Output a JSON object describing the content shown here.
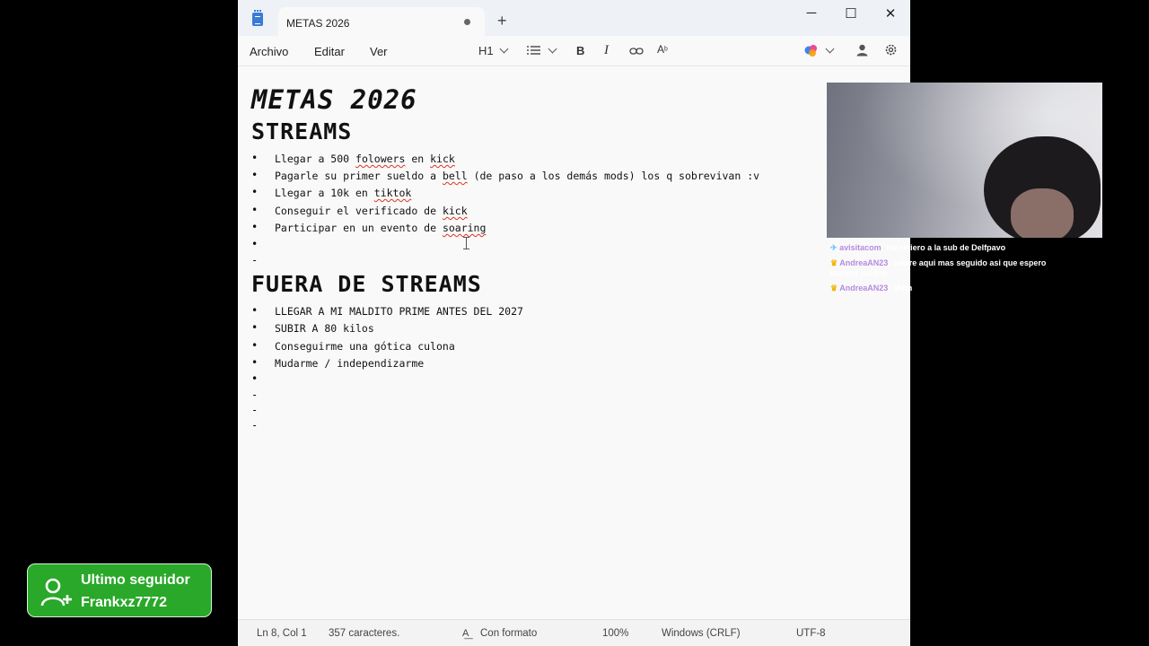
{
  "window": {
    "tab_title": "METAS 2026",
    "new_tab_label": "+",
    "minimize_label": "─",
    "maximize_label": "☐",
    "close_label": "✕"
  },
  "menu": {
    "items": [
      "Archivo",
      "Editar",
      "Ver"
    ]
  },
  "toolbar": {
    "heading_label": "H1",
    "list_icon": "list-icon",
    "bold_label": "B",
    "italic_label": "I",
    "link_icon": "link-icon",
    "clear_format_icon": "clear-formatting-icon",
    "copilot_icon": "copilot-icon",
    "account_icon": "account-icon",
    "settings_icon": "gear-icon"
  },
  "document": {
    "title": "METAS 2026",
    "section1": {
      "heading": "STREAMS",
      "items": [
        "Llegar a 500 folowers en kick",
        "Pagarle su primer sueldo a bell (de paso a los demás mods) los q sobrevivan :v",
        "Llegar a 10k en tiktok",
        "Conseguir el verificado de kick",
        "Participar en un evento de soaring",
        ""
      ]
    },
    "section2": {
      "heading": "FUERA DE STREAMS",
      "items": [
        "LLEGAR A MI MALDITO PRIME ANTES DEL 2027",
        "SUBIR A 80 kilos",
        "Conseguirme una gótica culona",
        "Mudarme / independizarme",
        ""
      ]
    },
    "bullet_char": "•",
    "dash_char": "-"
  },
  "statusbar": {
    "position": "Ln 8, Col 1",
    "chars": "357 caracteres.",
    "format": "Con formato",
    "zoom": "100%",
    "line_ending": "Windows (CRLF)",
    "encoding": "UTF-8"
  },
  "chat": {
    "messages": [
      {
        "user": "avisitacom",
        "text": "me refiero a la sub de Delfpavo"
      },
      {
        "user": "AndreaAN23",
        "text": "estare aqui mas seguido asi que espero nuevos juegos"
      },
      {
        "user": "AndreaAN23",
        "text": "ahhh"
      }
    ]
  },
  "follower": {
    "title": "Ultimo seguidor",
    "name": "Frankxz7772"
  },
  "colors": {
    "follower_bg": "#29a829",
    "spellcheck": "#d32222",
    "chat_user": "#b68be0"
  }
}
